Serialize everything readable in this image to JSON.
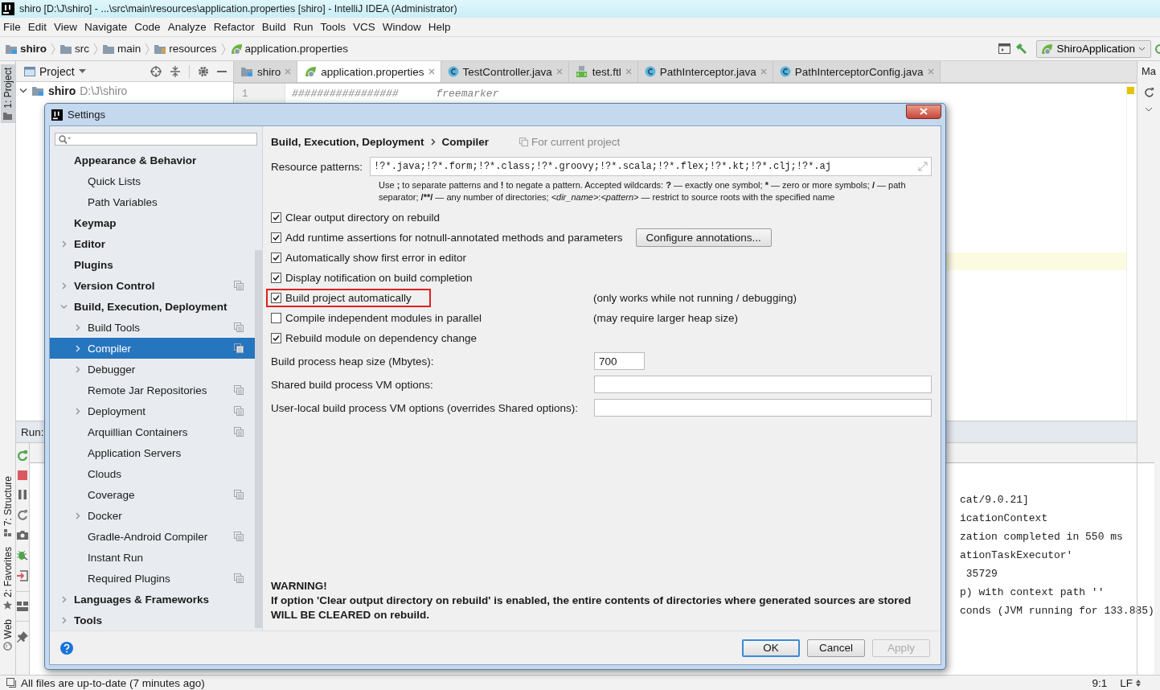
{
  "window": {
    "title": "shiro [D:\\J\\shiro] - ...\\src\\main\\resources\\application.properties [shiro] - IntelliJ IDEA (Administrator)"
  },
  "menu": [
    "File",
    "Edit",
    "View",
    "Navigate",
    "Code",
    "Analyze",
    "Refactor",
    "Build",
    "Run",
    "Tools",
    "VCS",
    "Window",
    "Help"
  ],
  "breadcrumbs": [
    {
      "label": "shiro",
      "kind": "module"
    },
    {
      "label": "src",
      "kind": "folder"
    },
    {
      "label": "main",
      "kind": "folder"
    },
    {
      "label": "resources",
      "kind": "resources"
    },
    {
      "label": "application.properties",
      "kind": "spring"
    }
  ],
  "run_config": {
    "label": "ShiroApplication"
  },
  "left_tool_windows": [
    {
      "label": "1: Project",
      "kind": "project"
    },
    {
      "label": "7: Structure",
      "kind": "structure"
    },
    {
      "label": "2: Favorites",
      "kind": "favorites"
    },
    {
      "label": "Web",
      "kind": "web"
    }
  ],
  "project_panel": {
    "title": "Project",
    "root": {
      "label": "shiro",
      "path": "D:\\J\\shiro",
      "expanded": true
    }
  },
  "editor_tabs": [
    {
      "label": "shiro",
      "kind": "module",
      "selected": false
    },
    {
      "label": "application.properties",
      "kind": "spring",
      "selected": true
    },
    {
      "label": "TestController.java",
      "kind": "class",
      "selected": false
    },
    {
      "label": "test.ftl",
      "kind": "template",
      "selected": false
    },
    {
      "label": "PathInterceptor.java",
      "kind": "class",
      "selected": false
    },
    {
      "label": "PathInterceptorConfig.java",
      "kind": "class",
      "selected": false
    }
  ],
  "editor": {
    "line_number": "1",
    "text": "#################      freemarker"
  },
  "right_tool_windows": [
    {
      "label": "Ma"
    }
  ],
  "run_panel": {
    "title": "Run:",
    "console": [
      "cat/9.0.21]",
      "icationContext",
      "zation completed in 550 ms",
      "ationTaskExecutor'",
      " 35729",
      "p) with context path ''",
      "conds (JVM running for 133.885)"
    ]
  },
  "status_bar": {
    "message": "All files are up-to-date (7 minutes ago)",
    "position": "9:1",
    "line_separator": "LF"
  },
  "dialog": {
    "title": "Settings",
    "tree": [
      {
        "label": "Appearance & Behavior",
        "selected": false,
        "project_level": false,
        "children": [
          {
            "label": "Quick Lists",
            "selected": false,
            "project_level": false
          },
          {
            "label": "Path Variables",
            "selected": false,
            "project_level": false
          }
        ]
      },
      {
        "label": "Keymap",
        "selected": false,
        "project_level": false
      },
      {
        "label": "Editor",
        "selected": false,
        "project_level": false,
        "expanded": false
      },
      {
        "label": "Plugins",
        "selected": false,
        "project_level": false
      },
      {
        "label": "Version Control",
        "selected": false,
        "project_level": true,
        "expanded": false
      },
      {
        "label": "Build, Execution, Deployment",
        "selected": false,
        "project_level": false,
        "expanded": true,
        "children": [
          {
            "label": "Build Tools",
            "selected": false,
            "project_level": true,
            "expanded": false
          },
          {
            "label": "Compiler",
            "selected": true,
            "project_level": true,
            "expanded": false
          },
          {
            "label": "Debugger",
            "selected": false,
            "project_level": false,
            "expanded": false
          },
          {
            "label": "Remote Jar Repositories",
            "selected": false,
            "project_level": true
          },
          {
            "label": "Deployment",
            "selected": false,
            "project_level": true,
            "expanded": false
          },
          {
            "label": "Arquillian Containers",
            "selected": false,
            "project_level": true
          },
          {
            "label": "Application Servers",
            "selected": false,
            "project_level": false
          },
          {
            "label": "Clouds",
            "selected": false,
            "project_level": false
          },
          {
            "label": "Coverage",
            "selected": false,
            "project_level": true
          },
          {
            "label": "Docker",
            "selected": false,
            "project_level": false,
            "expanded": false
          },
          {
            "label": "Gradle-Android Compiler",
            "selected": false,
            "project_level": true
          },
          {
            "label": "Instant Run",
            "selected": false,
            "project_level": false
          },
          {
            "label": "Required Plugins",
            "selected": false,
            "project_level": true
          }
        ]
      },
      {
        "label": "Languages & Frameworks",
        "selected": false,
        "project_level": false,
        "expanded": false
      },
      {
        "label": "Tools",
        "selected": false,
        "project_level": false,
        "expanded": false
      }
    ],
    "breadcrumb": [
      "Build, Execution, Deployment",
      "Compiler"
    ],
    "scope": "For current project",
    "resource_patterns": {
      "label": "Resource patterns:",
      "value": "!?*.java;!?*.form;!?*.class;!?*.groovy;!?*.scala;!?*.flex;!?*.kt;!?*.clj;!?*.aj",
      "hint": [
        "Use **;** to separate patterns and **!** to negate a pattern. Accepted wildcards: **?** — exactly one symbol; ***** — zero or more symbols; **/** — path separator; ",
        "/**/",
        " — any number of directories; *<dir_name>*:*<pattern>* — restrict to source roots with the specified name"
      ]
    },
    "options": [
      {
        "label": "Clear output directory on rebuild",
        "checked": true,
        "highlighted": false
      },
      {
        "label": "Add runtime assertions for notnull-annotated methods and parameters",
        "checked": true,
        "highlighted": false,
        "button": "Configure annotations..."
      },
      {
        "label": "Automatically show first error in editor",
        "checked": true,
        "highlighted": false
      },
      {
        "label": "Display notification on build completion",
        "checked": true,
        "highlighted": false
      },
      {
        "label": "Build project automatically",
        "checked": true,
        "highlighted": true,
        "note": "(only works while not running / debugging)"
      },
      {
        "label": "Compile independent modules in parallel",
        "checked": false,
        "highlighted": false,
        "note": "(may require larger heap size)"
      },
      {
        "label": "Rebuild module on dependency change",
        "checked": true,
        "highlighted": false
      }
    ],
    "fields": [
      {
        "label": "Build process heap size (Mbytes):",
        "value": "700",
        "kind": "short"
      },
      {
        "label": "Shared build process VM options:",
        "kind": "wide"
      },
      {
        "label": "User-local build process VM options (overrides Shared options):",
        "kind": "wide"
      }
    ],
    "warning": {
      "title": "WARNING!",
      "text": "If option 'Clear output directory on rebuild' is enabled, the entire contents of directories where generated sources are stored WILL BE CLEARED on rebuild."
    },
    "buttons": [
      {
        "label": "OK",
        "default": true,
        "disabled": false
      },
      {
        "label": "Cancel",
        "default": false,
        "disabled": false
      },
      {
        "label": "Apply",
        "default": false,
        "disabled": true
      }
    ]
  }
}
